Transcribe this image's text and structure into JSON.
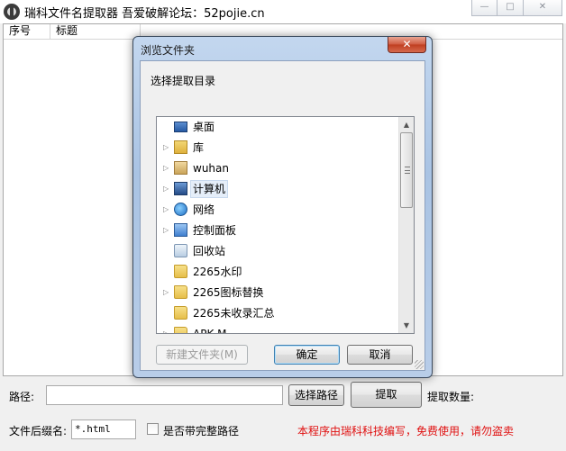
{
  "window": {
    "title": "瑞科文件名提取器   吾爱破解论坛：52pojie.cn",
    "minimize_glyph": "—",
    "maximize_glyph": "□",
    "close_glyph": "✕"
  },
  "list": {
    "columns": [
      "序号",
      "标题"
    ]
  },
  "bottom": {
    "path_label": "路径:",
    "path_value": "",
    "select_path_button": "选择路径",
    "extract_button": "提取",
    "extract_count_label": "提取数量:",
    "ext_label": "文件后缀名:",
    "ext_value": "*.html",
    "full_path_label": "是否带完整路径",
    "full_path_checked": false,
    "notice": "本程序由瑞科科技编写，免费使用，请勿盗卖",
    "notice_color": "#e01010"
  },
  "dialog": {
    "title": "浏览文件夹",
    "close_glyph": "✕",
    "prompt": "选择提取目录",
    "tree": [
      {
        "label": "桌面",
        "icon": "desktop-icon",
        "expandable": false,
        "selected": false
      },
      {
        "label": "库",
        "icon": "library-icon",
        "expandable": true,
        "selected": false
      },
      {
        "label": "wuhan",
        "icon": "user-folder-icon",
        "expandable": true,
        "selected": false
      },
      {
        "label": "计算机",
        "icon": "computer-icon",
        "expandable": true,
        "selected": true
      },
      {
        "label": "网络",
        "icon": "network-icon",
        "expandable": true,
        "selected": false
      },
      {
        "label": "控制面板",
        "icon": "control-panel-icon",
        "expandable": true,
        "selected": false
      },
      {
        "label": "回收站",
        "icon": "recycle-bin-icon",
        "expandable": false,
        "selected": false
      },
      {
        "label": "2265水印",
        "icon": "folder-icon",
        "expandable": false,
        "selected": false
      },
      {
        "label": "2265图标替换",
        "icon": "folder-icon",
        "expandable": true,
        "selected": false
      },
      {
        "label": "2265未收录汇总",
        "icon": "folder-icon",
        "expandable": false,
        "selected": false
      },
      {
        "label": "APK M...",
        "icon": "folder-icon",
        "expandable": true,
        "selected": false
      }
    ],
    "new_folder_button": "新建文件夹(M)",
    "ok_button": "确定",
    "cancel_button": "取消"
  }
}
